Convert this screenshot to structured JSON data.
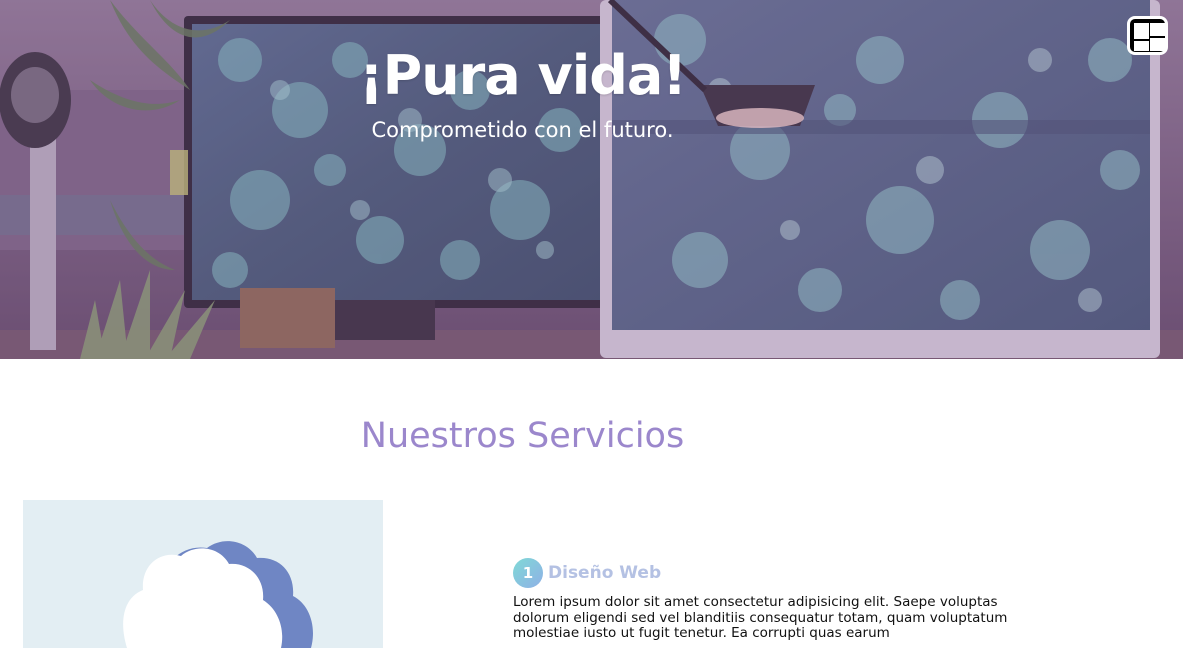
{
  "hero": {
    "title": "¡Pura vida!",
    "subtitle": "Comprometido con el futuro.",
    "overlay_color": "#9669a0",
    "menu_icon": "grid-menu-icon"
  },
  "services": {
    "heading": "Nuestros Servicios",
    "heading_color": "#9b87cc",
    "items": [
      {
        "number": "1",
        "title": "Diseño Web",
        "description": "Lorem ipsum dolor sit amet consectetur adipisicing elit. Saepe voluptas dolorum eligendi sed vel blanditiis consequatur totam, quam voluptatum molestiae iusto ut fugit tenetur. Ea corrupti quas earum",
        "icon": "cloud-icon"
      }
    ]
  }
}
